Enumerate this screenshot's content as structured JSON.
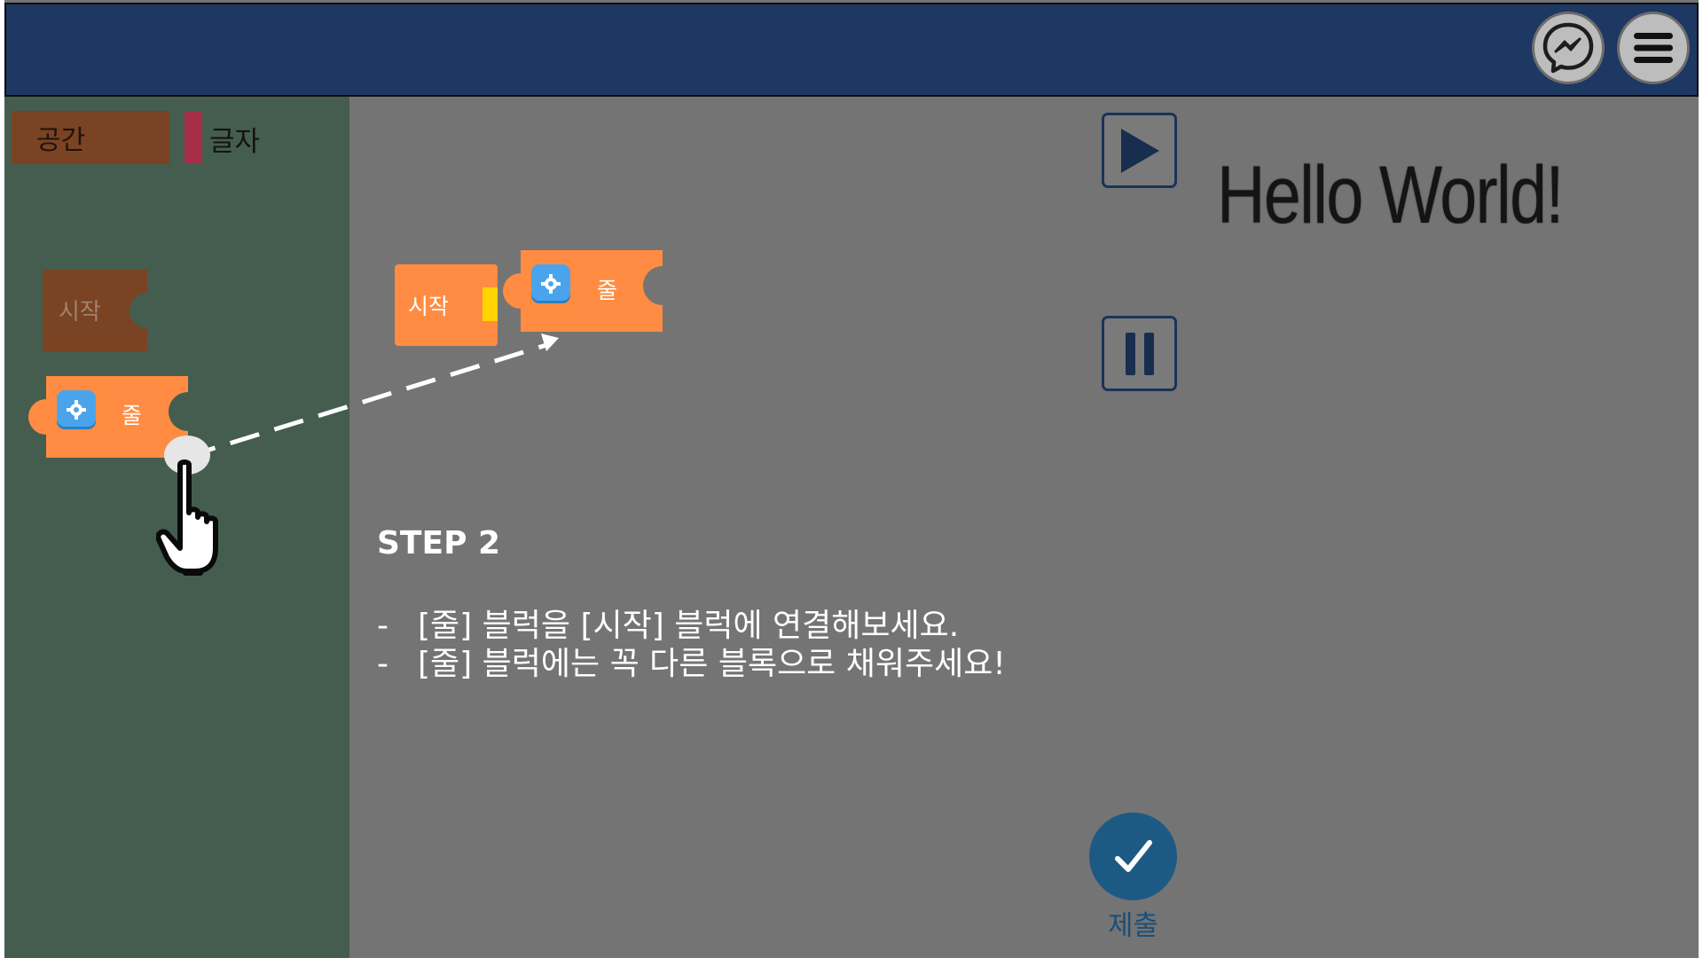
{
  "header": {
    "messenger_icon": "messenger-icon",
    "menu_icon": "hamburger-menu-icon"
  },
  "palette": {
    "tabs": [
      {
        "label": "공간",
        "color": "#7a4323"
      },
      {
        "label": "글자",
        "color": "#a52d45"
      }
    ],
    "blocks": {
      "start_label": "시작",
      "line_label": "줄"
    }
  },
  "workspace": {
    "start_label": "시작",
    "line_label": "줄"
  },
  "output": {
    "text": "Hello World!"
  },
  "controls": {
    "play_icon": "play-icon",
    "pause_icon": "pause-icon"
  },
  "instructions": {
    "title": "STEP 2",
    "lines": [
      "[줄] 블럭을 [시작] 블럭에 연결해보세요.",
      "[줄] 블럭에는 꼭 다른 블록으로 채워주세요!"
    ],
    "bullet": "-"
  },
  "submit": {
    "label": "제출",
    "icon": "checkmark-icon"
  },
  "colors": {
    "header": "#1d3862",
    "sidebar": "#445d4f",
    "workspace": "#747474",
    "block_orange": "#ff8c42",
    "block_start_dim": "#7a4323",
    "submit": "#1c5a84"
  }
}
